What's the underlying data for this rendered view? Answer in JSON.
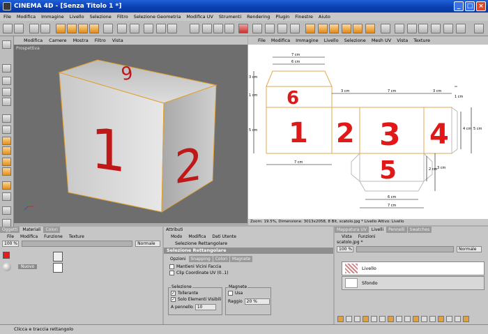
{
  "window": {
    "app_name": "CINEMA 4D",
    "doc_title": "[Senza Titolo 1 *]",
    "title_sep": " - "
  },
  "menubar": [
    "File",
    "Modifica",
    "Immagine",
    "Livello",
    "Selezione",
    "Filtro",
    "Selezione Geometria",
    "Modifica UV",
    "Strumenti",
    "Rendering",
    "Plugin",
    "Finestre",
    "Aiuto"
  ],
  "viewport": {
    "menu": [
      "Modifica",
      "Camere",
      "Mostra",
      "Filtro",
      "Vista"
    ],
    "label": "Prospettiva"
  },
  "bodypaint": {
    "menu": [
      "File",
      "Modifica",
      "Immagine",
      "Livello",
      "Selezione",
      "Mesh UV",
      "Vista",
      "Texture"
    ],
    "status": "Zoom: 19.5%, Dimensione: 3013x2058, 8 Bit, scatolo.jpg * Livello Attivo: Livello",
    "dims": {
      "top_w": "7 cm",
      "top_inner": "6 cm",
      "side1": "3 cm",
      "mid": "7 cm",
      "side2": "3 cm",
      "right_h": "4 cm",
      "right_total": "5 cm",
      "left_v1": "3 cm",
      "left_v2": "1 cm",
      "left_v3": "5 cm",
      "bottom_w": "7 cm",
      "bot_h1": "2 cm",
      "bot_h2": "3 cm",
      "bot_inner": "6 cm",
      "bot_total": "7 cm",
      "top_right": "1 cm"
    },
    "numbers": [
      "6",
      "1",
      "2",
      "3",
      "4",
      "5"
    ]
  },
  "materials": {
    "tabs": [
      "Oggetti",
      "Materiali",
      "Colori"
    ],
    "menu": [
      "File",
      "Modifica",
      "Funzione",
      "Texture"
    ],
    "zoom": "100 %",
    "mode": "Normale",
    "item": "Nuovo"
  },
  "attributes": {
    "tab": "Attributi",
    "menu": [
      "Modo",
      "Modifica",
      "Dati Utente"
    ],
    "tool": "Selezione Rettangolare",
    "section": "Selezione Rettangolare",
    "subtabs": [
      "Opzioni",
      "Snapping",
      "Colori",
      "Magnete"
    ],
    "opt1": "Mantieni Vicini Faccia",
    "opt2": "Clip Coordinate UV (0..1)",
    "sel_group": "Selezione",
    "tolerant": "Tollerante",
    "visible_only": "Solo Elementi Visibili",
    "brush_label": "A pennello",
    "brush_val": "10",
    "mag_group": "Magnete",
    "use": "Usa",
    "radius_label": "Raggio",
    "radius_val": "20 %"
  },
  "layers": {
    "tabs": [
      "Mappatura UV",
      "Livelli",
      "Pennelli",
      "Swatches"
    ],
    "menu": [
      "Vista",
      "Funzioni"
    ],
    "file": "scatolo.jpg *",
    "zoom": "100 %",
    "mode": "Normale",
    "items": [
      "Livello",
      "Sfondo"
    ]
  },
  "statusbar": "Clicca e traccia rettangolo"
}
